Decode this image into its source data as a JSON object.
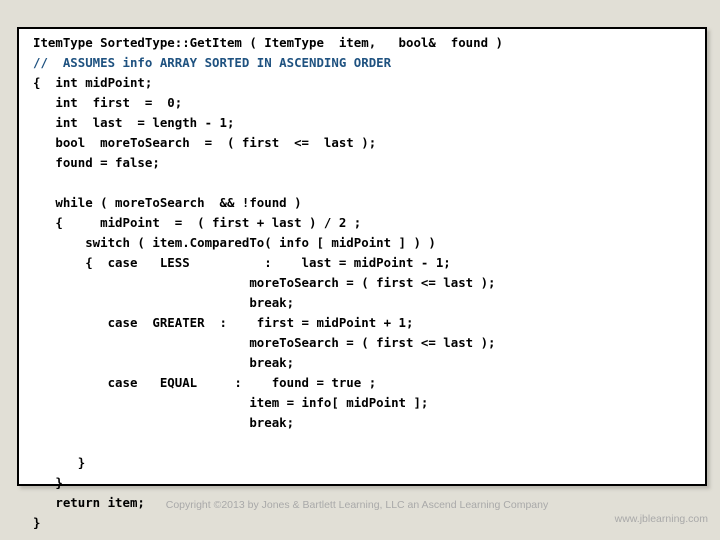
{
  "slide": {
    "background_color": "#e1dfd6",
    "code_panel": {
      "background_color": "#ffffff",
      "border_color": "#000000",
      "comment_color": "#1f5280",
      "code_color": "#000000",
      "lines": [
        {
          "text": "ItemType SortedType::GetItem ( ItemType  item,   bool&  found )",
          "kind": "code"
        },
        {
          "text": "//  ASSUMES info ARRAY SORTED IN ASCENDING ORDER",
          "kind": "comment"
        },
        {
          "text": "{  int midPoint;",
          "kind": "code"
        },
        {
          "text": "   int  first  =  0;",
          "kind": "code"
        },
        {
          "text": "   int  last  = length - 1;",
          "kind": "code"
        },
        {
          "text": "   bool  moreToSearch  =  ( first  <=  last );",
          "kind": "code"
        },
        {
          "text": "   found = false;",
          "kind": "code"
        },
        {
          "text": "",
          "kind": "code"
        },
        {
          "text": "   while ( moreToSearch  && !found )",
          "kind": "code"
        },
        {
          "text": "   {     midPoint  =  ( first + last ) / 2 ;",
          "kind": "code"
        },
        {
          "text": "       switch ( item.ComparedTo( info [ midPoint ] ) )",
          "kind": "code"
        },
        {
          "text": "       {  case   LESS          :    last = midPoint - 1;",
          "kind": "code"
        },
        {
          "text": "                             moreToSearch = ( first <= last );",
          "kind": "code"
        },
        {
          "text": "                             break;",
          "kind": "code"
        },
        {
          "text": "          case  GREATER  :    first = midPoint + 1;",
          "kind": "code"
        },
        {
          "text": "                             moreToSearch = ( first <= last );",
          "kind": "code"
        },
        {
          "text": "                             break;",
          "kind": "code"
        },
        {
          "text": "          case   EQUAL     :    found = true ;",
          "kind": "code"
        },
        {
          "text": "                             item = info[ midPoint ];",
          "kind": "code"
        },
        {
          "text": "                             break;",
          "kind": "code"
        },
        {
          "text": "",
          "kind": "code"
        },
        {
          "text": "      }",
          "kind": "code"
        },
        {
          "text": "   }",
          "kind": "code"
        },
        {
          "text": "   return item;",
          "kind": "code"
        },
        {
          "text": "}",
          "kind": "code"
        }
      ]
    }
  },
  "footer": {
    "copyright": "Copyright ©2013 by Jones & Bartlett Learning, LLC an Ascend Learning Company",
    "url": "www.jblearning.com",
    "color": "#a9a9a9"
  }
}
